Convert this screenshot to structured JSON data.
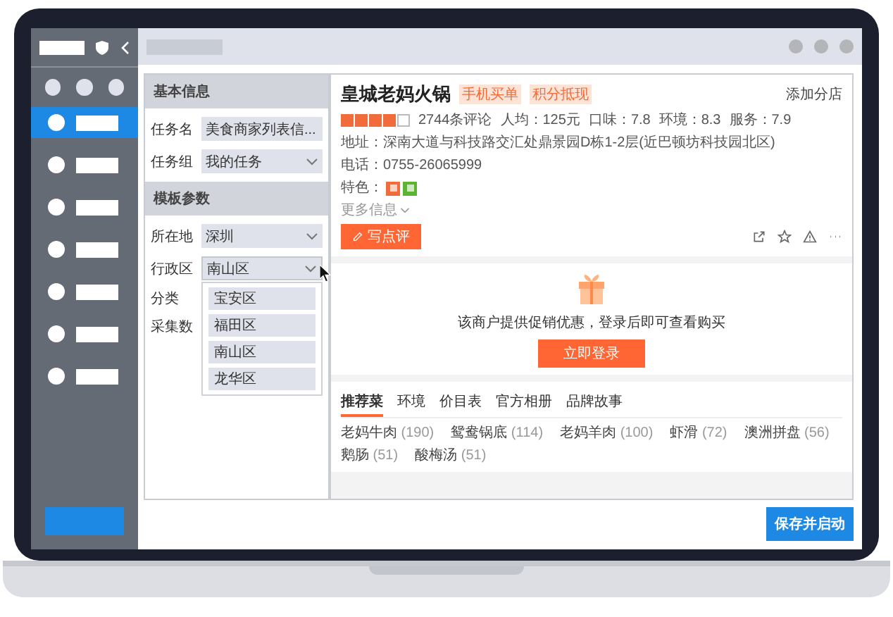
{
  "sidebar": {
    "nav_items": [
      {
        "selected": true
      },
      {
        "selected": false
      },
      {
        "selected": false
      },
      {
        "selected": false
      },
      {
        "selected": false
      },
      {
        "selected": false
      },
      {
        "selected": false
      }
    ]
  },
  "form": {
    "sections": [
      {
        "title": "基本信息",
        "fields": [
          {
            "label": "任务名",
            "kind": "input",
            "value": "美食商家列表信..."
          },
          {
            "label": "任务组",
            "kind": "select",
            "value": "我的任务",
            "expanded": false
          }
        ]
      },
      {
        "title": "模板参数",
        "fields": [
          {
            "label": "所在地",
            "kind": "select",
            "value": "深圳",
            "expanded": false
          },
          {
            "label": "行政区",
            "kind": "select",
            "value": "南山区",
            "expanded": true,
            "options": [
              "宝安区",
              "福田区",
              "南山区",
              "龙华区"
            ]
          },
          {
            "label": "分类",
            "kind": "label"
          },
          {
            "label": "采集数",
            "kind": "label"
          }
        ]
      }
    ]
  },
  "shop": {
    "name": "皇城老妈火锅",
    "tags": [
      "手机买单",
      "积分抵现"
    ],
    "add_branch": "添加分店",
    "stars": 4,
    "stats": [
      "2744条评论",
      "人均：125元",
      "口味：7.8",
      "环境：8.3",
      "服务：7.9"
    ],
    "address_label": "地址：",
    "address": "深南大道与科技路交汇处鼎景园D栋1-2层(近巴顿坊科技园北区)",
    "phone_label": "电话：",
    "phone": "0755-26065999",
    "features_label": "特色：",
    "features": [
      {
        "color": "#f26b3a"
      },
      {
        "color": "#5cb531"
      }
    ],
    "more": "更多信息",
    "review_button": "写点评"
  },
  "promo": {
    "text": "该商户提供促销优惠，登录后即可查看购买",
    "button": "立即登录"
  },
  "tabs": [
    {
      "label": "推荐菜",
      "selected": true
    },
    {
      "label": "环境",
      "selected": false
    },
    {
      "label": "价目表",
      "selected": false
    },
    {
      "label": "官方相册",
      "selected": false
    },
    {
      "label": "品牌故事",
      "selected": false
    }
  ],
  "dishes": [
    {
      "name": "老妈牛肉",
      "count": "(190)"
    },
    {
      "name": "鸳鸯锅底",
      "count": "(114)"
    },
    {
      "name": "老妈羊肉",
      "count": "(100)"
    },
    {
      "name": "虾滑",
      "count": "(72)"
    },
    {
      "name": "澳洲拼盘",
      "count": "(56)"
    },
    {
      "name": "鹅肠",
      "count": "(51)"
    },
    {
      "name": "酸梅汤",
      "count": "(51)"
    }
  ],
  "save_button": "保存并启动"
}
